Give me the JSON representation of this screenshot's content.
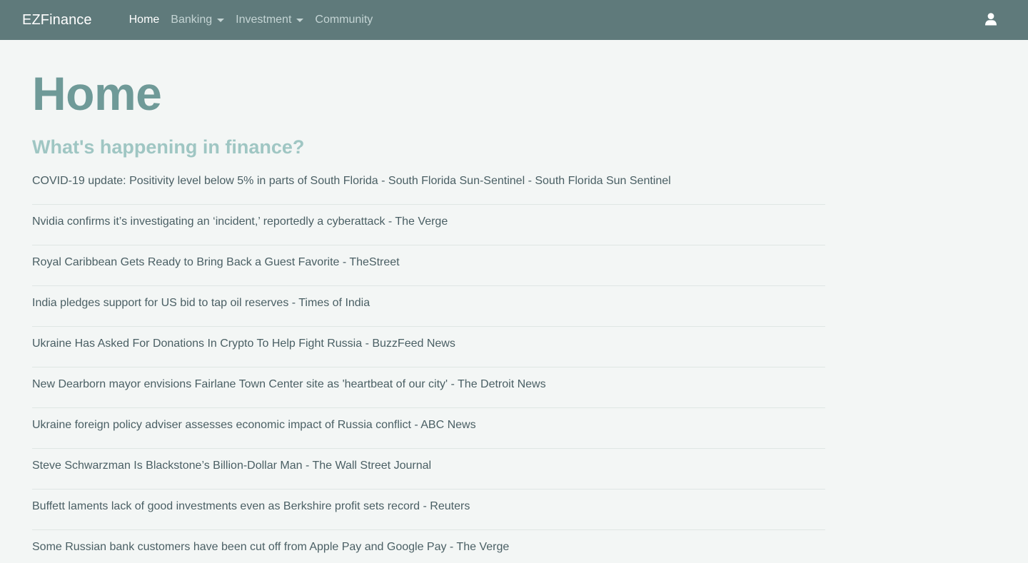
{
  "navbar": {
    "brand": "EZFinance",
    "links": [
      {
        "label": "Home"
      },
      {
        "label": "Banking"
      },
      {
        "label": "Investment"
      },
      {
        "label": "Community"
      }
    ],
    "user_icon": "user-icon"
  },
  "main": {
    "title": "Home",
    "subtitle": "What's happening in finance?",
    "news": [
      {
        "headline": "COVID-19 update: Positivity level below 5% in parts of South Florida - South Florida Sun-Sentinel - South Florida Sun Sentinel"
      },
      {
        "headline": "Nvidia confirms it’s investigating an ‘incident,’ reportedly a cyberattack - The Verge"
      },
      {
        "headline": "Royal Caribbean Gets Ready to Bring Back a Guest Favorite - TheStreet"
      },
      {
        "headline": "India pledges support for US bid to tap oil reserves - Times of India"
      },
      {
        "headline": "Ukraine Has Asked For Donations In Crypto To Help Fight Russia - BuzzFeed News"
      },
      {
        "headline": "New Dearborn mayor envisions Fairlane Town Center site as 'heartbeat of our city' - The Detroit News"
      },
      {
        "headline": "Ukraine foreign policy adviser assesses economic impact of Russia conflict - ABC News"
      },
      {
        "headline": "Steve Schwarzman Is Blackstone’s Billion-Dollar Man - The Wall Street Journal"
      },
      {
        "headline": "Buffett laments lack of good investments even as Berkshire profit sets record - Reuters"
      },
      {
        "headline": "Some Russian bank customers have been cut off from Apple Pay and Google Pay - The Verge"
      }
    ]
  },
  "colors": {
    "navbar_bg": "#5f7a7b",
    "page_bg": "#f3f6f5",
    "title": "#6f9a98",
    "subtitle": "#9fc6c3",
    "link_text": "#4a5f64"
  }
}
